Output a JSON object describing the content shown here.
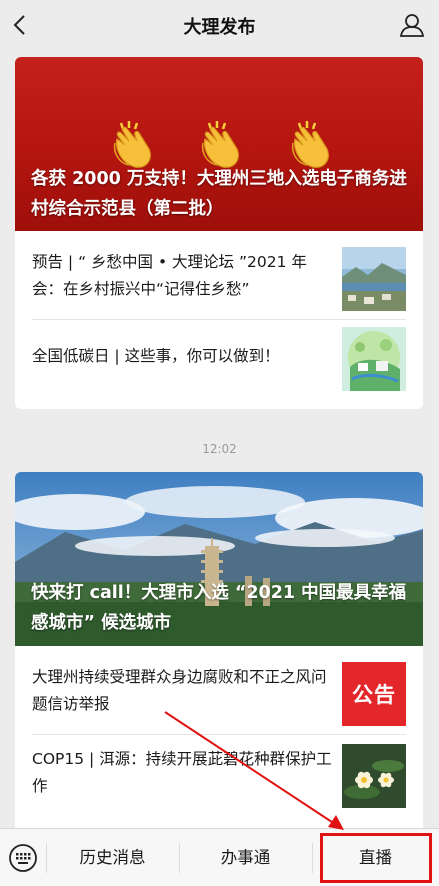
{
  "header": {
    "title": "大理发布"
  },
  "card1": {
    "hero_title": "各获 2000 万支持！大理州三地入选电子商务进村综合示范县（第二批）",
    "items": [
      {
        "text": "预告 | “ 乡愁中国 • 大理论坛 ”2021 年会：在乡村振兴中“记得住乡愁”"
      },
      {
        "text": "全国低碳日 | 这些事，你可以做到！"
      }
    ]
  },
  "timestamp": "12:02",
  "card2": {
    "hero_title": "快来打 call！大理市入选 “2021 中国最具幸福感城市” 候选城市",
    "items": [
      {
        "text": "大理州持续受理群众身边腐败和不正之风问题信访举报",
        "badge": "公告"
      },
      {
        "text": "COP15 | 洱源：持续开展茈碧花种群保护工作"
      }
    ]
  },
  "bottom_menu": {
    "items": [
      {
        "label": "历史消息"
      },
      {
        "label": "办事通"
      },
      {
        "label": "直播"
      }
    ]
  },
  "icons": {
    "back": "chevron-left-icon",
    "profile": "person-icon",
    "keyboard": "keyboard-icon"
  },
  "colors": {
    "highlight": "#e11212",
    "notice_badge": "#e3262a"
  }
}
